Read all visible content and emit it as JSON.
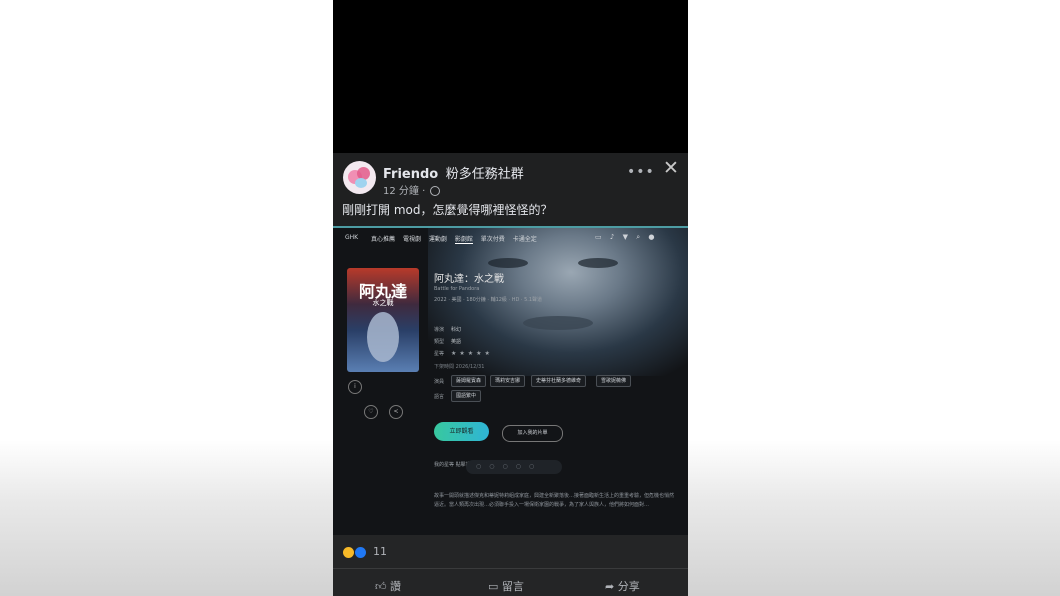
{
  "post": {
    "group_name": "Friendo",
    "group_tag": "粉多任務社群",
    "time": "12 分鐘 ·",
    "more_label": "•••",
    "close_label": "✕",
    "text": "剛剛打開 mod，怎麼覺得哪裡怪怪的？"
  },
  "app": {
    "nav_logo": "GHK",
    "nav_items": [
      "真心推薦",
      "電視劇",
      "運動劇",
      "影劇館",
      "單次付費",
      "卡通全定"
    ],
    "nav_icons": [
      "battery-icon",
      "bell-icon",
      "filter-icon",
      "search-icon",
      "user-icon"
    ],
    "poster_title": "阿丸達",
    "poster_subtitle": "水之戰",
    "title": "阿丸達：水之戰",
    "subtitle": "Battle for Pandora",
    "meta_line": "2022 · 美國 · 180分鐘 · 輔12級 · HD · 5.1聲道",
    "rows": [
      {
        "label": "導演",
        "value": "科幻"
      },
      {
        "label": "類型",
        "value": "英語"
      },
      {
        "label": "星等",
        "value": ""
      }
    ],
    "stars": "★★★★★",
    "updated": "下架時間 2026/12/31",
    "tags_label": "演員",
    "tags": [
      "薩姆羅賓森",
      "瑪莉安吉娜",
      "史蒂芬杜蘭多德維奇",
      "雪歌妮薇佛"
    ],
    "lang_label": "語言",
    "lang": "國語繁中",
    "primary_button": "立即觀看",
    "secondary_button": "加入我的片單",
    "rate_label": "我的星等 點擊評分",
    "rate_stars": "○○○○○",
    "description": "故事一開頭就描述傑克和蒂妮特莉組成家庭，興建全新聚落後…接著面臨新生活上的重重考驗，但危機也悄然逼近。當人類再次出現…必須聯手投入一場保衛家園的戰爭，為了家人與族人，他們將如何面對…",
    "heart_icon": "heart-icon",
    "share_icon": "share-icon",
    "info_icon": "info-icon"
  },
  "footer": {
    "reaction_count": "11",
    "like_label": "讚",
    "comment_label": "留言",
    "share_label": "分享"
  },
  "colors": {
    "accent_teal": "#4d9ca3",
    "primary_gradient_start": "#38c89e",
    "primary_gradient_end": "#2fb5d6",
    "like_blue": "#2078f4",
    "haha_yellow": "#f7b928"
  }
}
